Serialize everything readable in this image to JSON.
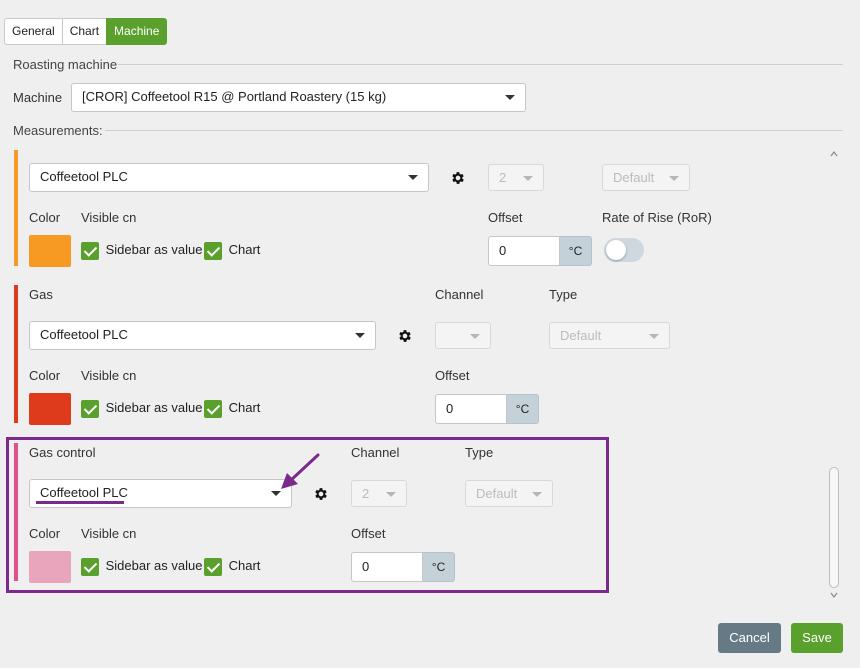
{
  "tabs": [
    {
      "label": "General"
    },
    {
      "label": "Chart"
    },
    {
      "label": "Machine"
    }
  ],
  "roasting_machine": {
    "section_title": "Roasting machine",
    "machine_label": "Machine",
    "machine_value": "[CROR] Coffeetool R15 @ Portland Roastery (15 kg)"
  },
  "measurements": {
    "section_title": "Measurements:",
    "items": [
      {
        "name": "",
        "bar_color": "#f79a24",
        "source": "Coffeetool PLC",
        "channel": "2",
        "type": "Default",
        "color_label": "Color",
        "visible_on_label": "Visible cn",
        "swatch_color": "#f79a24",
        "sidebar_label": "Sidebar as value",
        "chart_label": "Chart",
        "offset_label": "Offset",
        "offset_value": "0",
        "unit": "°C",
        "ror_label": "Rate of Rise (RoR)",
        "ror_enabled": false
      },
      {
        "name": "Gas",
        "bar_color": "#de3b1d",
        "source": "Coffeetool PLC",
        "channel_label": "Channel",
        "channel": "",
        "type_label": "Type",
        "type": "Default",
        "color_label": "Color",
        "visible_on_label": "Visible cn",
        "swatch_color": "#de3b1d",
        "sidebar_label": "Sidebar as value",
        "chart_label": "Chart",
        "offset_label": "Offset",
        "offset_value": "0",
        "unit": "°C"
      },
      {
        "name": "Gas control",
        "bar_color": "#e2508a",
        "source": "Coffeetool PLC",
        "channel_label": "Channel",
        "channel": "2",
        "type_label": "Type",
        "type": "Default",
        "color_label": "Color",
        "visible_on_label": "Visible cn",
        "swatch_color": "#e8a5bb",
        "sidebar_label": "Sidebar as value",
        "chart_label": "Chart",
        "offset_label": "Offset",
        "offset_value": "0",
        "unit": "°C"
      }
    ]
  },
  "highlight_color": "#7b2a8c",
  "footer": {
    "cancel_label": "Cancel",
    "save_label": "Save"
  },
  "colors": {
    "accent": "#5aa02c",
    "cancel": "#667a86"
  }
}
